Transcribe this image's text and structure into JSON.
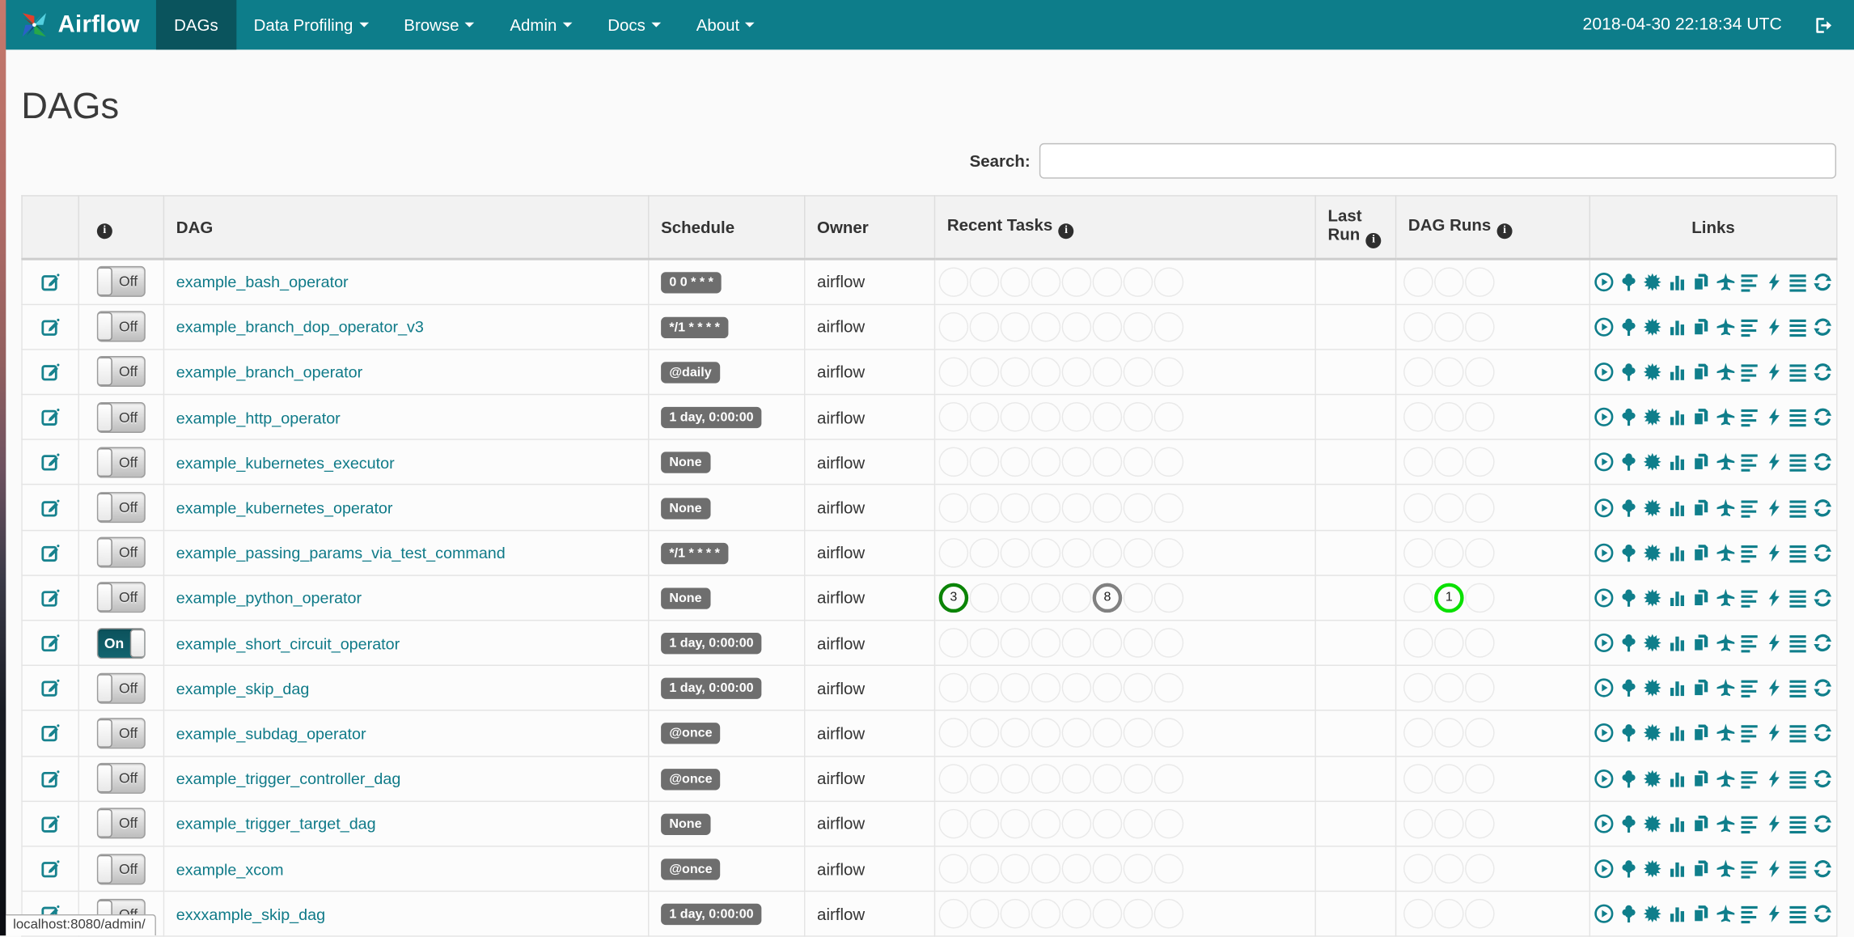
{
  "navbar": {
    "brand": "Airflow",
    "items": [
      {
        "label": "DAGs",
        "active": true,
        "caret": false
      },
      {
        "label": "Data Profiling",
        "active": false,
        "caret": true
      },
      {
        "label": "Browse",
        "active": false,
        "caret": true
      },
      {
        "label": "Admin",
        "active": false,
        "caret": true
      },
      {
        "label": "Docs",
        "active": false,
        "caret": true
      },
      {
        "label": "About",
        "active": false,
        "caret": true
      }
    ],
    "clock": "2018-04-30 22:18:34 UTC",
    "logout_icon": "sign-out-icon"
  },
  "page": {
    "title": "DAGs"
  },
  "search": {
    "label": "Search:",
    "value": ""
  },
  "table": {
    "headers": [
      {
        "label": "",
        "info": false
      },
      {
        "label": "",
        "info": true
      },
      {
        "label": "DAG",
        "info": false
      },
      {
        "label": "Schedule",
        "info": false
      },
      {
        "label": "Owner",
        "info": false
      },
      {
        "label": "Recent Tasks",
        "info": true
      },
      {
        "label": "Last Run",
        "info": true
      },
      {
        "label": "DAG Runs",
        "info": true
      },
      {
        "label": "Links",
        "info": false,
        "align": "center"
      }
    ],
    "recent_task_slots": 8,
    "dag_run_slots": 3,
    "rows": [
      {
        "dag": "example_bash_operator",
        "toggle": "Off",
        "schedule": "0 0 * * *",
        "owner": "airflow",
        "last_run": "",
        "recent_tasks": {},
        "dag_runs": {}
      },
      {
        "dag": "example_branch_dop_operator_v3",
        "toggle": "Off",
        "schedule": "*/1 * * * *",
        "owner": "airflow",
        "last_run": "",
        "recent_tasks": {},
        "dag_runs": {}
      },
      {
        "dag": "example_branch_operator",
        "toggle": "Off",
        "schedule": "@daily",
        "owner": "airflow",
        "last_run": "",
        "recent_tasks": {},
        "dag_runs": {}
      },
      {
        "dag": "example_http_operator",
        "toggle": "Off",
        "schedule": "1 day, 0:00:00",
        "owner": "airflow",
        "last_run": "",
        "recent_tasks": {},
        "dag_runs": {}
      },
      {
        "dag": "example_kubernetes_executor",
        "toggle": "Off",
        "schedule": "None",
        "owner": "airflow",
        "last_run": "",
        "recent_tasks": {},
        "dag_runs": {}
      },
      {
        "dag": "example_kubernetes_operator",
        "toggle": "Off",
        "schedule": "None",
        "owner": "airflow",
        "last_run": "",
        "recent_tasks": {},
        "dag_runs": {}
      },
      {
        "dag": "example_passing_params_via_test_command",
        "toggle": "Off",
        "schedule": "*/1 * * * *",
        "owner": "airflow",
        "last_run": "",
        "recent_tasks": {},
        "dag_runs": {}
      },
      {
        "dag": "example_python_operator",
        "toggle": "Off",
        "schedule": "None",
        "owner": "airflow",
        "last_run": "",
        "recent_tasks": {
          "0": {
            "count": "3",
            "state": "success"
          },
          "5": {
            "count": "8",
            "state": "queued"
          }
        },
        "dag_runs": {
          "1": {
            "count": "1",
            "state": "running"
          }
        }
      },
      {
        "dag": "example_short_circuit_operator",
        "toggle": "On",
        "schedule": "1 day, 0:00:00",
        "owner": "airflow",
        "last_run": "",
        "recent_tasks": {},
        "dag_runs": {}
      },
      {
        "dag": "example_skip_dag",
        "toggle": "Off",
        "schedule": "1 day, 0:00:00",
        "owner": "airflow",
        "last_run": "",
        "recent_tasks": {},
        "dag_runs": {}
      },
      {
        "dag": "example_subdag_operator",
        "toggle": "Off",
        "schedule": "@once",
        "owner": "airflow",
        "last_run": "",
        "recent_tasks": {},
        "dag_runs": {}
      },
      {
        "dag": "example_trigger_controller_dag",
        "toggle": "Off",
        "schedule": "@once",
        "owner": "airflow",
        "last_run": "",
        "recent_tasks": {},
        "dag_runs": {}
      },
      {
        "dag": "example_trigger_target_dag",
        "toggle": "Off",
        "schedule": "None",
        "owner": "airflow",
        "last_run": "",
        "recent_tasks": {},
        "dag_runs": {}
      },
      {
        "dag": "example_xcom",
        "toggle": "Off",
        "schedule": "@once",
        "owner": "airflow",
        "last_run": "",
        "recent_tasks": {},
        "dag_runs": {}
      },
      {
        "dag": "exxxample_skip_dag",
        "toggle": "Off",
        "schedule": "1 day, 0:00:00",
        "owner": "airflow",
        "last_run": "",
        "recent_tasks": {},
        "dag_runs": {}
      }
    ]
  },
  "links": {
    "icons": [
      {
        "name": "trigger-dag",
        "glyph": "play-circle"
      },
      {
        "name": "tree-view",
        "glyph": "tree"
      },
      {
        "name": "graph-view",
        "glyph": "burst"
      },
      {
        "name": "task-duration",
        "glyph": "bar-chart"
      },
      {
        "name": "task-tries",
        "glyph": "files"
      },
      {
        "name": "landing-times",
        "glyph": "plane"
      },
      {
        "name": "gantt-view",
        "glyph": "align-left"
      },
      {
        "name": "code-view",
        "glyph": "bolt"
      },
      {
        "name": "logs",
        "glyph": "align-justify"
      },
      {
        "name": "refresh",
        "glyph": "refresh"
      }
    ]
  },
  "status_bar": {
    "url": "localhost:8080/admin/"
  },
  "colors": {
    "navbar": "#0d7d8a",
    "navbar_active": "#0a545d",
    "link_teal": "#0f7a88",
    "badge_gray": "#6e6e6e",
    "task_success": "#0b8406",
    "task_queued": "#818181",
    "dagrun_running": "#0ae000",
    "circle_empty": "#e9e9e9"
  }
}
